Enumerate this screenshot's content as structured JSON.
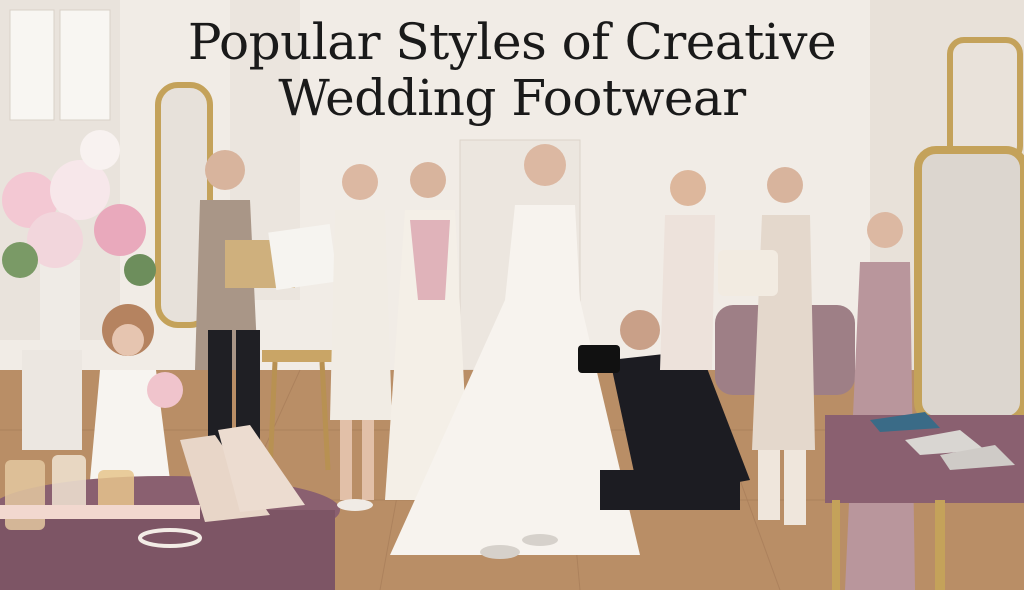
{
  "title": {
    "line1": "Popular Styles of Creative",
    "line2": "Wedding Footwear"
  },
  "colors": {
    "wall": "#efe9e3",
    "floor": "#b58b62",
    "table_cloth": "#8a6070",
    "gold": "#c4a25a",
    "suit": "#1d1d22",
    "gown": "#f6f2ec"
  }
}
